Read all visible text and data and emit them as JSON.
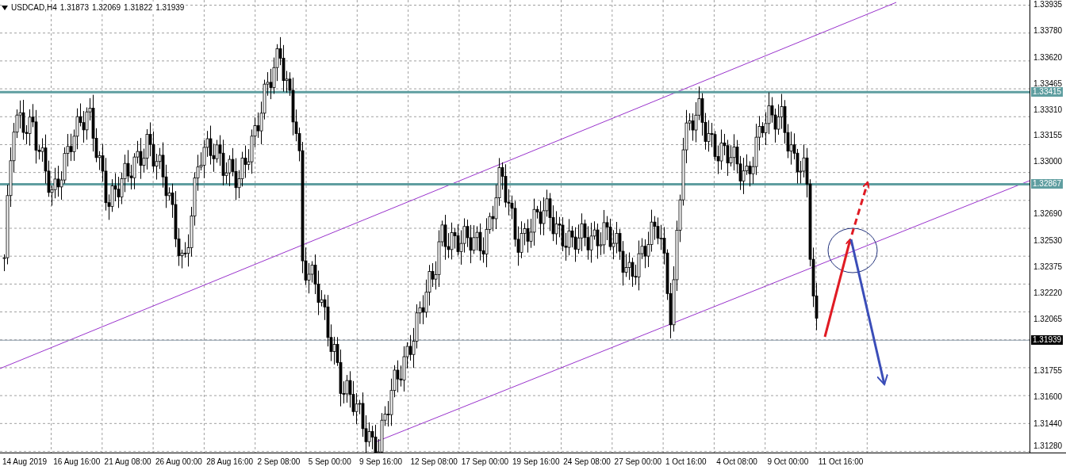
{
  "chart": {
    "symbol": "USDCAD,H4",
    "ohlc": [
      "1.31873",
      "1.32069",
      "1.31822",
      "1.31939"
    ]
  },
  "price_axis": {
    "labels": [
      "1.33935",
      "1.33780",
      "1.33620",
      "1.33465",
      "1.33310",
      "1.33155",
      "1.33000",
      "1.32690",
      "1.32530",
      "1.32375",
      "1.32220",
      "1.32065",
      "1.31755",
      "1.31600",
      "1.31440",
      "1.31280"
    ]
  },
  "price_tags": [
    {
      "text": "1.33415",
      "kind": "level"
    },
    {
      "text": "1.32867",
      "kind": "level"
    },
    {
      "text": "1.31939",
      "kind": "bid"
    }
  ],
  "time_axis": {
    "labels": [
      "14 Aug 2019",
      "16 Aug 16:00",
      "21 Aug 08:00",
      "26 Aug 00:00",
      "28 Aug 16:00",
      "2 Sep 08:00",
      "5 Sep 00:00",
      "9 Sep 16:00",
      "12 Sep 08:00",
      "17 Sep 00:00",
      "19 Sep 16:00",
      "24 Sep 08:00",
      "27 Sep 00:00",
      "1 Oct 16:00",
      "4 Oct 08:00",
      "9 Oct 00:00",
      "11 Oct 16:00"
    ]
  }
}
